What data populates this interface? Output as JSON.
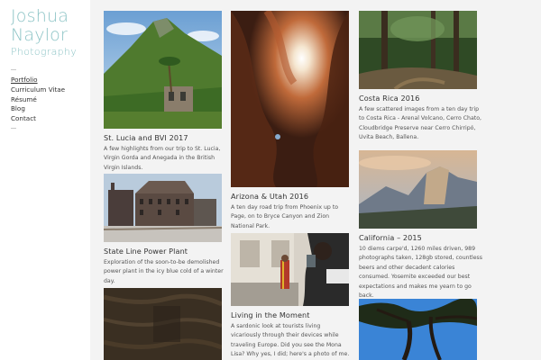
{
  "brand": {
    "line1": "Joshua",
    "line2": "Naylor",
    "sub": "Photography"
  },
  "nav": [
    "Portfolio",
    "Curriculum Vitae",
    "Résumé",
    "Blog",
    "Contact"
  ],
  "nav_active": "Portfolio",
  "colors": {
    "brand": "#8dc4c6",
    "page_bg": "#f3f3f3",
    "sidebar_bg": "#ffffff"
  },
  "cards": [
    {
      "title": "St. Lucia and BVI 2017",
      "desc": "A few highlights from our trip to St. Lucia, Virgin Gorda and Anegada in the British Virgin Islands."
    },
    {
      "title": "State Line Power Plant",
      "desc": "Exploration of the soon-to-be demolished power plant in the icy blue cold of a winter day."
    },
    {
      "title": "Arizona & Utah 2016",
      "desc": "A ten day road trip from Phoenix up to Page, on to Bryce Canyon and Zion National Park."
    },
    {
      "title": "Living in the Moment",
      "desc": "A sardonic look at tourists living vicariously through their devices while traveling Europe. Did you see the Mona Lisa? Why yes, I did; here's a photo of me."
    },
    {
      "title": "Costa Rica 2016",
      "desc": "A few scattered images from a ten day trip to Costa Rica - Arenal Volcano, Cerro Chato, Cloudbridge Preserve near Cerro Chirripó, Uvita Beach, Ballena."
    },
    {
      "title": "California – 2015",
      "desc": "10 diems carpe'd, 1260 miles driven, 989 photographs taken, 128gb stored, countless beers and other decadent calories consumed. Yosemite exceeded our best expectations and makes me yearn to go back."
    }
  ]
}
